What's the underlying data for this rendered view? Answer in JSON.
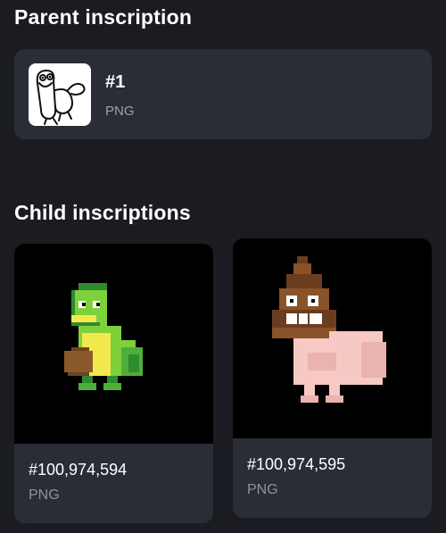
{
  "parent_section": {
    "title": "Parent inscription",
    "item": {
      "number": "#1",
      "type": "PNG",
      "thumbnail_icon": "doodle-duck-icon"
    }
  },
  "child_section": {
    "title": "Child inscriptions",
    "items": [
      {
        "number": "#100,974,594",
        "type": "PNG",
        "image_icon": "pixel-green-duck-icon",
        "colors": {
          "body": "#7fd13b",
          "dark": "#2e8b2e",
          "belly": "#f2e94e",
          "hand": "#8b5a2b"
        }
      },
      {
        "number": "#100,974,595",
        "type": "PNG",
        "image_icon": "pixel-poop-pig-icon",
        "colors": {
          "poop": "#6b3d1f",
          "body": "#f6c9c4",
          "teeth": "#ffffff"
        }
      }
    ]
  }
}
